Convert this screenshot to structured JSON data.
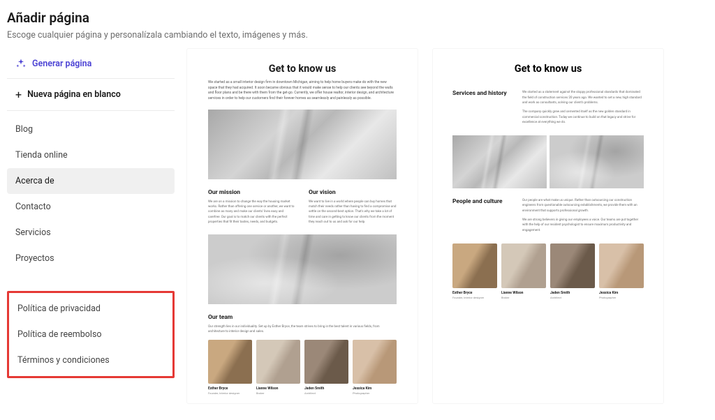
{
  "header": {
    "title": "Añadir página",
    "subtitle": "Escoge cualquier página y personalízala cambiando el texto, imágenes y más."
  },
  "sidebar": {
    "generate_label": "Generar página",
    "blank_label": "Nueva página en blanco",
    "items": [
      {
        "label": "Blog"
      },
      {
        "label": "Tienda online"
      },
      {
        "label": "Acerca de"
      },
      {
        "label": "Contacto"
      },
      {
        "label": "Servicios"
      },
      {
        "label": "Proyectos"
      }
    ],
    "highlighted": [
      {
        "label": "Política de privacidad"
      },
      {
        "label": "Política de reembolso"
      },
      {
        "label": "Términos y condiciones"
      }
    ]
  },
  "preview1": {
    "heading": "Get to know us",
    "intro": "We started as a small interior design firm in downtown Michigan, aiming to help home buyers make do with the new space that they had acquired. It soon became obvious that it would make sense to help our clients see beyond the walls and floor plans and be there with them from the get-go. Currently, we offer house realtor, interior design, and architecture services in order to help our customers find their forever homes as seamlessly and painlessly as possible.",
    "mission_heading": "Our mission",
    "mission_text": "We are on a mission to change the way the housing market works. Rather than offering one service or another, we want to combine as many and make our clients' lives easy and carefree. Our goal is to match our clients with the perfect properties that fit their tastes, needs, and budgets.",
    "vision_heading": "Our vision",
    "vision_text": "We want to live in a world where people can buy homes that match their needs rather than having to find a compromise and settle on the second-best option. That's why we take a lot of time and care in getting to know our clients from the moment they reach out to us and ask for our help.",
    "team_heading": "Our team",
    "team_text": "Our strength lies in our individuality. Set up by Esther Bryce, the team strives to bring in the best talent in various fields, from architecture to interior design and sales.",
    "members": [
      {
        "name": "Esther Bryce",
        "role": "Founder, Interior designer"
      },
      {
        "name": "Lianne Wilson",
        "role": "Broker"
      },
      {
        "name": "Jaden Smith",
        "role": "Architect"
      },
      {
        "name": "Jessica Kim",
        "role": "Photographer"
      }
    ]
  },
  "preview2": {
    "heading": "Get to know us",
    "services_heading": "Services and history",
    "services_text1": "We started as a statement against the sloppy professional standards that dominated the field of construction services 20 years ago. We wanted to set a new, high standard and work as consultants, solving our client's problems.",
    "services_text2": "The company quickly grew and cemented itself as the new golden standard in commercial construction. Today we continue to build on that legacy and strive for excellence at everything we do.",
    "people_heading": "People and culture",
    "people_text1": "Our people are what make us unique. Rather than outsourcing our construction engineers from questionable outsourcing establishments, we provide them with an environment that supports professional growth.",
    "people_text2": "We are strong believers in giving our employees a voice. Our teams are put together with the help of our resident psychologist to ensure maximum productivity and engagement.",
    "members": [
      {
        "name": "Esther Bryce",
        "role": "Founder, Interior designer"
      },
      {
        "name": "Lianne Wilson",
        "role": "Broker"
      },
      {
        "name": "Jaden Smith",
        "role": "Architect"
      },
      {
        "name": "Jessica Kim",
        "role": "Photographer"
      }
    ]
  }
}
